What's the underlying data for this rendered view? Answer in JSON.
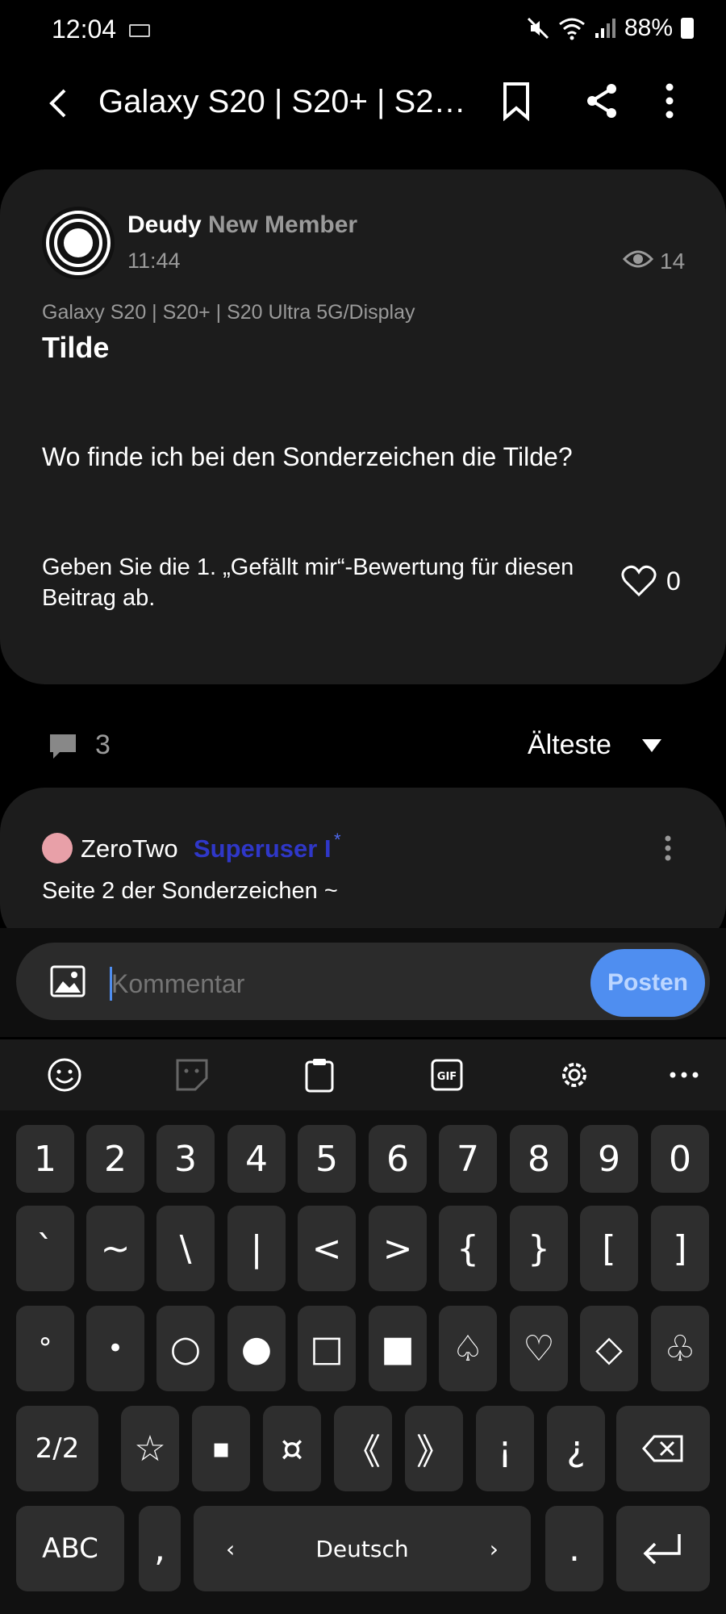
{
  "status_bar": {
    "time": "12:04",
    "battery": "88%"
  },
  "app_bar": {
    "title": "Galaxy S20 | S20+ | S20..."
  },
  "post": {
    "author": "Deudy",
    "role": "New Member",
    "time": "11:44",
    "views": "14",
    "category": "Galaxy S20 | S20+ | S20 Ultra 5G/Display",
    "title": "Tilde",
    "body": "Wo finde ich bei den Sonderzeichen die Tilde?",
    "like_prompt": "Geben Sie die 1. „Gefällt mir“-Bewertung für diesen Beitrag ab.",
    "like_count": "0"
  },
  "comments_bar": {
    "count": "3",
    "sort": "Älteste"
  },
  "comment": {
    "author": "ZeroTwo",
    "role": "Superuser I",
    "role_mark": "*",
    "text": "Seite 2 der Sonderzeichen ~"
  },
  "composer": {
    "placeholder": "Kommentar",
    "post_button": "Posten"
  },
  "keyboard": {
    "row1": [
      "1",
      "2",
      "3",
      "4",
      "5",
      "6",
      "7",
      "8",
      "9",
      "0"
    ],
    "row2": [
      "`",
      "~",
      "\\",
      "|",
      "<",
      ">",
      "{",
      "}",
      "[",
      "]"
    ],
    "row3": [
      "°",
      "•",
      "○",
      "●",
      "□",
      "■",
      "♤",
      "♡",
      "◇",
      "♧"
    ],
    "row4_page": "2/2",
    "row4": [
      "☆",
      "▪",
      "¤",
      "《",
      "》",
      "¡",
      "¿"
    ],
    "abc": "ABC",
    "comma": ",",
    "language": "Deutsch",
    "period": "."
  },
  "colors": {
    "accent": "#4f8ef0",
    "superuser": "#2f37c8",
    "card": "#1c1c1c"
  }
}
